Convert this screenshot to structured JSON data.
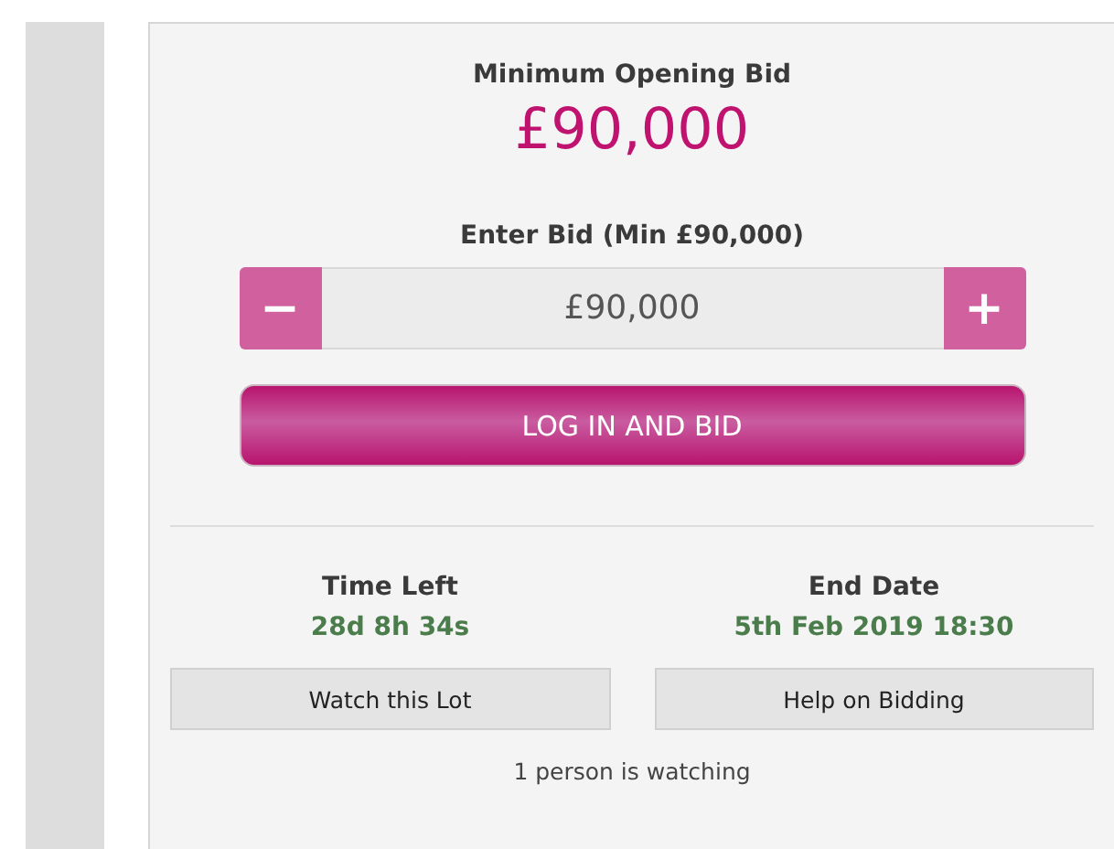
{
  "opening_bid": {
    "label": "Minimum Opening Bid",
    "amount": "£90,000"
  },
  "bid_entry": {
    "label": "Enter Bid (Min £90,000)",
    "decrease": "−",
    "value": "£90,000",
    "increase": "+"
  },
  "login_button": "LOG IN AND BID",
  "details": [
    {
      "label": "Time Left",
      "value": "28d 8h 34s"
    },
    {
      "label": "End Date",
      "value": "5th Feb 2019 18:30"
    }
  ],
  "actions": [
    "Watch this Lot",
    "Help on Bidding"
  ],
  "watchers": "1 person is watching"
}
